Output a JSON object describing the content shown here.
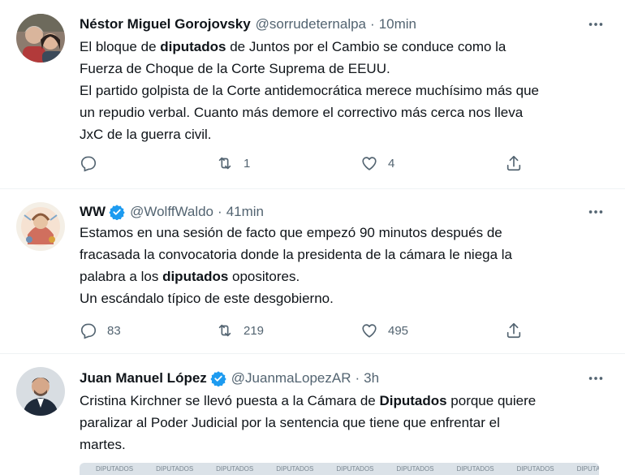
{
  "tweets": [
    {
      "name": "Néstor Miguel Gorojovsky",
      "handle": "@sorrudeternalpa",
      "time": "10min",
      "verified": false,
      "avatar": "avatar-couple",
      "lines": [
        [
          {
            "t": "El bloque de "
          },
          {
            "t": "diputados",
            "b": true
          },
          {
            "t": " de Juntos por el Cambio se conduce como la"
          }
        ],
        [
          {
            "t": "Fuerza de Choque de la Corte Suprema de EEUU."
          }
        ],
        [
          {
            "t": "El partido golpista de la Corte antidemocrática merece muchísimo más que"
          }
        ],
        [
          {
            "t": "un repudio verbal. Cuanto más demore el correctivo más cerca nos lleva"
          }
        ],
        [
          {
            "t": "JxC de la guerra civil."
          }
        ]
      ],
      "reply_count": "",
      "retweet_count": "1",
      "like_count": "4"
    },
    {
      "name": "WW",
      "handle": "@WolffWaldo",
      "time": "41min",
      "verified": true,
      "avatar": "avatar-illustration",
      "lines": [
        [
          {
            "t": "Estamos en una sesión de facto que empezó 90 minutos después de"
          }
        ],
        [
          {
            "t": "fracasada la convocatoria donde la presidenta de la cámara le niega la"
          }
        ],
        [
          {
            "t": "palabra a los "
          },
          {
            "t": "diputados",
            "b": true
          },
          {
            "t": " opositores."
          }
        ],
        [
          {
            "t": "Un escándalo típico de este desgobierno."
          }
        ]
      ],
      "reply_count": "83",
      "retweet_count": "219",
      "like_count": "495"
    },
    {
      "name": "Juan Manuel López",
      "handle": "@JuanmaLopezAR",
      "time": "3h",
      "verified": true,
      "avatar": "avatar-man",
      "lines": [
        [
          {
            "t": "Cristina Kirchner se llevó puesta a la Cámara de "
          },
          {
            "t": "Diputados",
            "b": true
          },
          {
            "t": " porque quiere"
          }
        ],
        [
          {
            "t": "paralizar al Poder Judicial por la sentencia que tiene que enfrentar el"
          }
        ],
        [
          {
            "t": "martes."
          }
        ]
      ]
    }
  ],
  "separator": "·",
  "media_labels": [
    "DIPUTADOS",
    "DIPUTADOS",
    "DIPUTADOS",
    "DIPUTADOS",
    "DIPUTADOS",
    "DIPUTADOS",
    "DIPUTADOS",
    "DIPUTADOS",
    "DIPUTADOS",
    "DIPUTADOS"
  ],
  "colors": {
    "verified": "#1d9bf0",
    "secondary": "#536471",
    "text": "#0f1419",
    "divider": "#eff3f4"
  },
  "icons": [
    "reply-icon",
    "retweet-icon",
    "like-icon",
    "share-icon",
    "more-icon",
    "verified-icon"
  ]
}
